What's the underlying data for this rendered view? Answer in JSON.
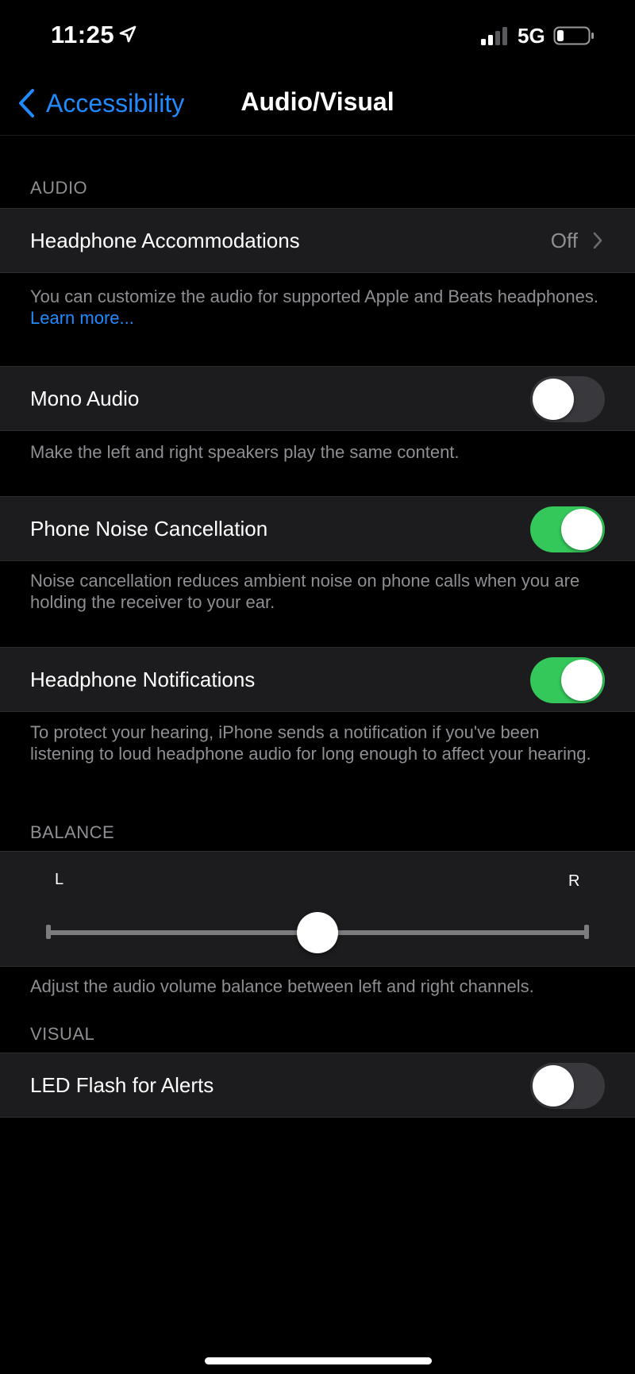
{
  "status_bar": {
    "time": "11:25",
    "carrier": "5G",
    "icons": [
      "location-arrow-icon",
      "cellular-signal-icon",
      "battery-icon"
    ]
  },
  "nav": {
    "back_label": "Accessibility",
    "title": "Audio/Visual"
  },
  "audio": {
    "header": "AUDIO",
    "headphone_accommodations": {
      "label": "Headphone Accommodations",
      "value": "Off"
    },
    "headphone_footer_text": "You can customize the audio for supported Apple and Beats headphones. ",
    "headphone_footer_link": "Learn more...",
    "mono_audio": {
      "label": "Mono Audio",
      "on": false,
      "footer": "Make the left and right speakers play the same content."
    },
    "phone_noise_cancellation": {
      "label": "Phone Noise Cancellation",
      "on": true,
      "footer": "Noise cancellation reduces ambient noise on phone calls when you are holding the receiver to your ear."
    },
    "headphone_notifications": {
      "label": "Headphone Notifications",
      "on": true,
      "footer": "To protect your hearing, iPhone sends a notification if you've been listening to loud headphone audio for long enough to affect your hearing."
    }
  },
  "balance": {
    "header": "BALANCE",
    "left_label": "L",
    "right_label": "R",
    "value": 0.5,
    "footer": "Adjust the audio volume balance between left and right channels."
  },
  "visual": {
    "header": "VISUAL",
    "led_flash": {
      "label": "LED Flash for Alerts",
      "on": false
    }
  },
  "colors": {
    "accent": "#1f8bff",
    "toggle_on": "#34c759",
    "toggle_off": "#39393d",
    "cell_bg": "#1c1c1e",
    "secondary_text": "#8e8e93"
  }
}
